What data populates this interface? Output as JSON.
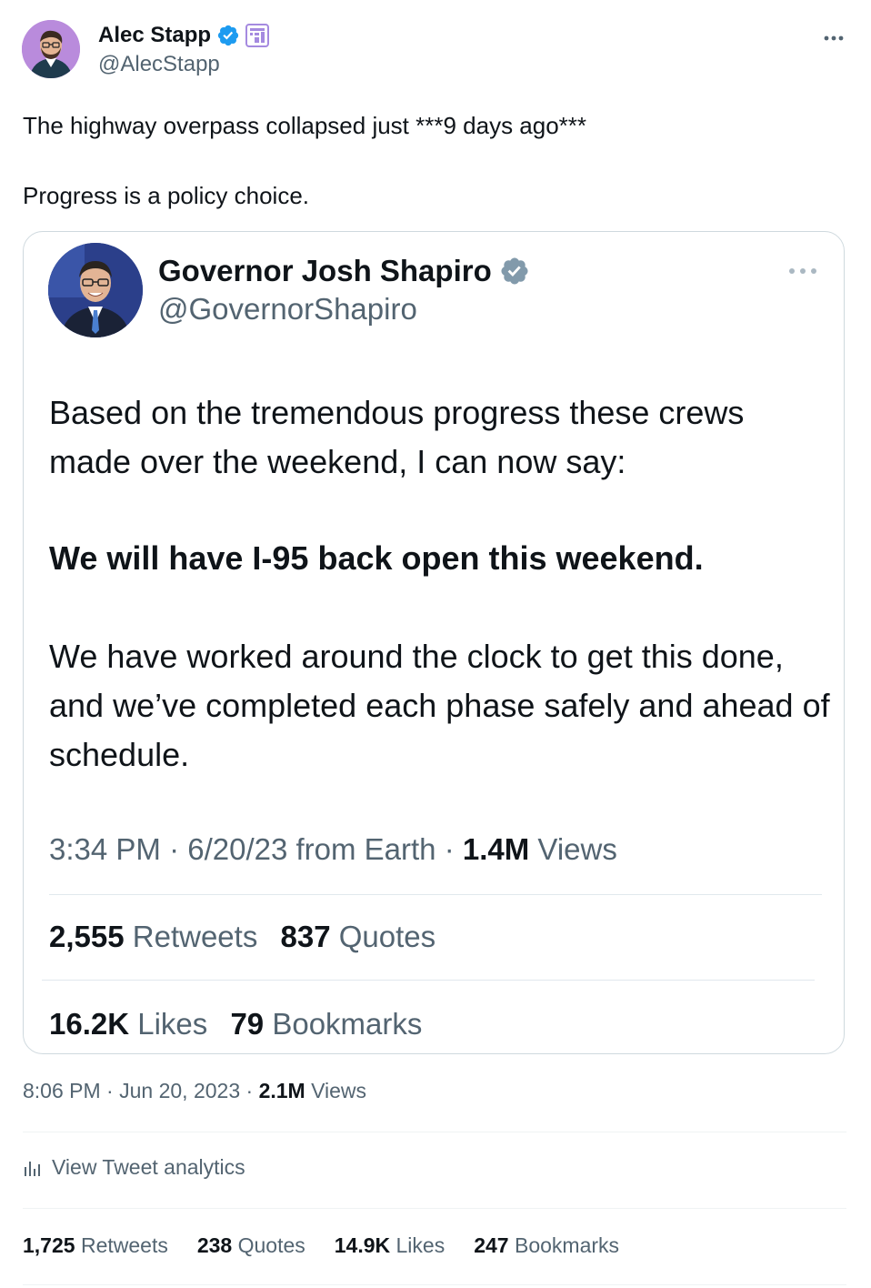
{
  "tweet": {
    "author_name": "Alec Stapp",
    "author_handle": "@AlecStapp",
    "paragraph1": "The highway overpass collapsed just ***9 days ago***",
    "paragraph2": "Progress is a policy choice.",
    "time": "8:06 PM",
    "date": "Jun 20, 2023",
    "views_count": "2.1M",
    "views_label": "Views",
    "analytics_label": "View Tweet analytics",
    "stats": [
      {
        "count": "1,725",
        "label": "Retweets"
      },
      {
        "count": "238",
        "label": "Quotes"
      },
      {
        "count": "14.9K",
        "label": "Likes"
      },
      {
        "count": "247",
        "label": "Bookmarks"
      }
    ]
  },
  "quoted": {
    "author_name": "Governor Josh Shapiro",
    "author_handle": "@GovernorShapiro",
    "paragraph1": "Based on the tremendous progress these crews made over the weekend, I can now say:",
    "paragraph2": "We will have I-95 back open this weekend.",
    "paragraph3": "We have worked around the clock to get this done, and we’ve completed each phase safely and ahead of schedule.",
    "meta_prefix": "3:34 PM · 6/20/23 from Earth · ",
    "views_count": "1.4M",
    "views_label": "Views",
    "retweets_count": "2,555",
    "retweets_label": "Retweets",
    "quotes_count": "837",
    "quotes_label": "Quotes",
    "likes_count": "16.2K",
    "likes_label": "Likes",
    "bookmarks_count": "79",
    "bookmarks_label": "Bookmarks"
  },
  "icons": {
    "verified": "verified-badge-icon",
    "affiliate": "affiliate-badge-icon",
    "more": "more-options-icon",
    "analytics": "bar-chart-icon"
  },
  "colors": {
    "verified_blue": "#1d9bf0",
    "verified_gray": "#829aab",
    "text_primary": "#0f1419",
    "text_secondary": "#536471"
  }
}
